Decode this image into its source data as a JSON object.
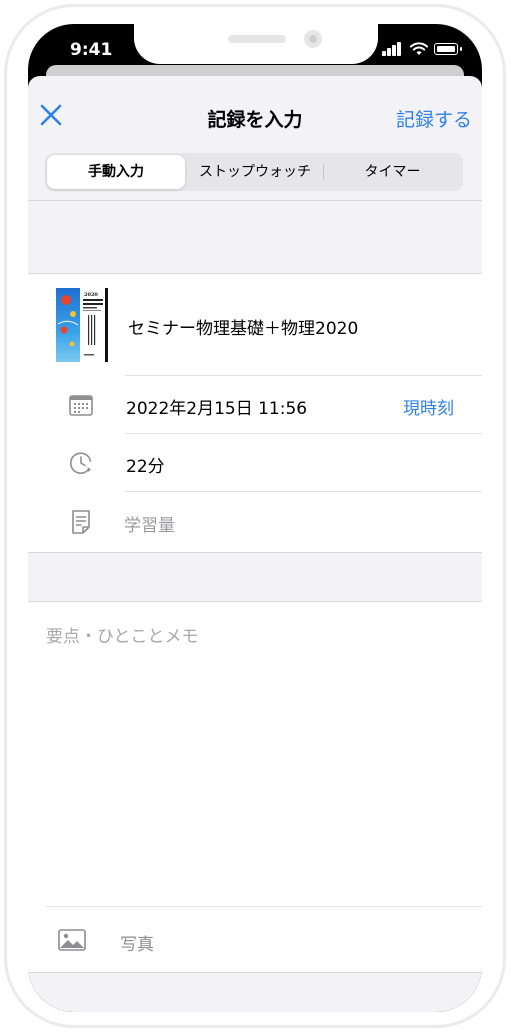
{
  "status_bar": {
    "time": "9:41"
  },
  "nav": {
    "title": "記録を入力",
    "record_button": "記録する",
    "close_icon": "close-icon"
  },
  "segmented": {
    "tabs": [
      "手動入力",
      "ストップウォッチ",
      "タイマー"
    ],
    "selected": "手動入力"
  },
  "book": {
    "title": "セミナー物理基礎＋物理2020",
    "cover_year": "2020"
  },
  "date_row": {
    "value": "2022年2月15日 11:56",
    "action": "現時刻",
    "icon": "calendar-icon"
  },
  "duration_row": {
    "value": "22分",
    "icon": "clock-icon"
  },
  "amount_row": {
    "placeholder": "学習量",
    "icon": "note-icon"
  },
  "memo": {
    "placeholder": "要点・ひとことメモ"
  },
  "photo": {
    "label": "写真",
    "icon": "photo-icon"
  },
  "colors": {
    "accent": "#2f80ed",
    "background": "#f2f2f7"
  }
}
